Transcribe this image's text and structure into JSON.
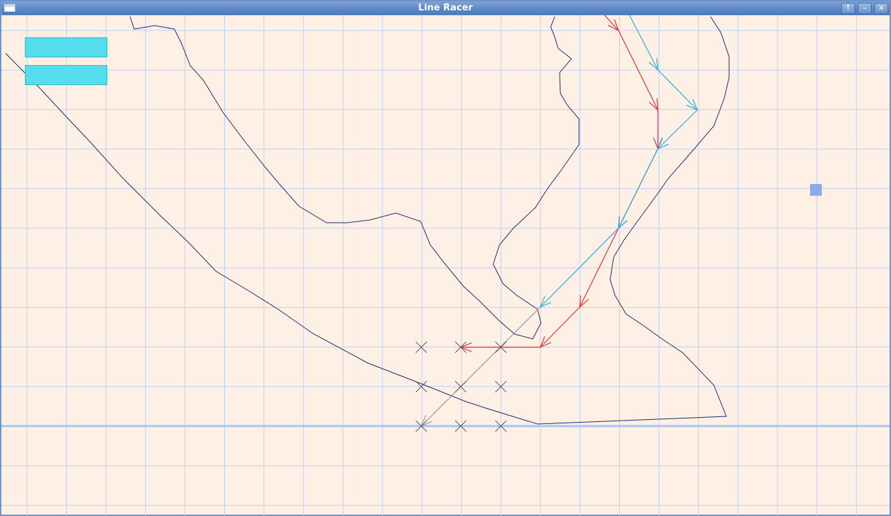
{
  "window": {
    "title": "Line Racer",
    "buttons": {
      "up": "↑",
      "minimize": "–",
      "close": "✕"
    }
  },
  "board": {
    "background_color": "#fff0e6",
    "grid_color": "#bcd0f7",
    "track_color": "#1a2a6b",
    "player_color": "#e23030",
    "opponent_color": "#2aa7e0",
    "option_marker": "x-icon"
  },
  "panels": {
    "count": 2,
    "color": "#55dced"
  },
  "marker": {
    "color": "#8aaaf4"
  }
}
